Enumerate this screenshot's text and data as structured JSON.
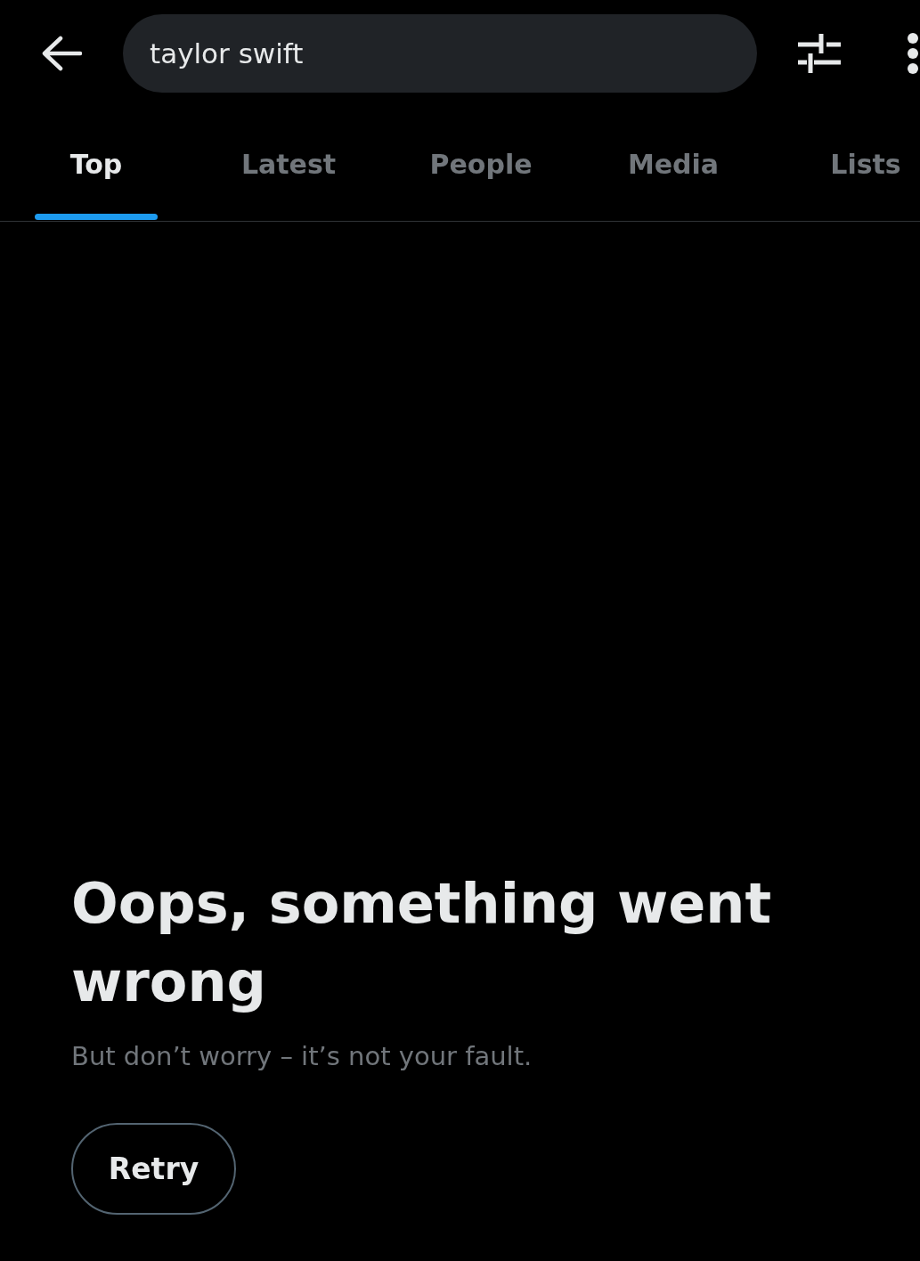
{
  "search": {
    "value": "taylor swift"
  },
  "tabs": [
    {
      "label": "Top",
      "selected": true
    },
    {
      "label": "Latest",
      "selected": false
    },
    {
      "label": "People",
      "selected": false
    },
    {
      "label": "Media",
      "selected": false
    },
    {
      "label": "Lists",
      "selected": false
    }
  ],
  "error": {
    "title": "Oops, something went wrong",
    "message": "But don’t worry – it’s not your fault.",
    "button": "Retry"
  }
}
